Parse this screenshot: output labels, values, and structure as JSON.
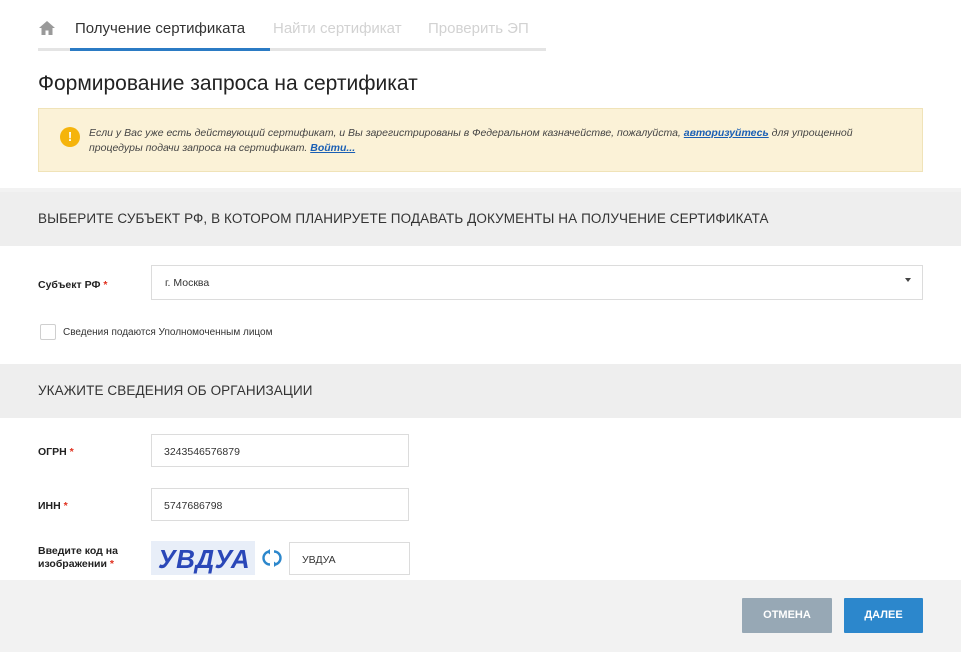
{
  "nav": {
    "tabs": [
      {
        "label": "Получение сертификата",
        "active": true
      },
      {
        "label": "Найти сертификат",
        "active": false
      },
      {
        "label": "Проверить ЭП",
        "active": false
      }
    ],
    "home_icon": "home-icon"
  },
  "page": {
    "title": "Формирование запроса на сертификат"
  },
  "notice": {
    "icon": "info-icon",
    "icon_glyph": "!",
    "text_before": "Если у Вас уже есть действующий сертификат, и Вы зарегистрированы в Федеральном казначействе, пожалуйста,",
    "link_authorize": "авторизуйтесь",
    "text_after": "для упрощенной процедуры подачи запроса на сертификат.",
    "link_login": "Войти..."
  },
  "section_region": {
    "header": "ВЫБЕРИТЕ СУБЪЕКТ РФ, В КОТОРОМ ПЛАНИРУЕТЕ ПОДАВАТЬ ДОКУМЕНТЫ НА ПОЛУЧЕНИЕ СЕРТИФИКАТА",
    "subject_label": "Субъект РФ",
    "subject_value": "г. Москва",
    "checkbox_label": "Сведения подаются Уполномоченным лицом",
    "checkbox_checked": false
  },
  "section_org": {
    "header": "УКАЖИТЕ СВЕДЕНИЯ ОБ ОРГАНИЗАЦИИ",
    "ogrn_label": "ОГРН",
    "ogrn_value": "3243546576879",
    "inn_label": "ИНН",
    "inn_value": "5747686798",
    "captcha_label_1": "Введите код на",
    "captcha_label_2": "изображении",
    "captcha_image_text": "УВДУА",
    "captcha_value": "УВДУА"
  },
  "required_mark": "*",
  "buttons": {
    "cancel": "ОТМЕНА",
    "next": "ДАЛЕЕ"
  },
  "colors": {
    "accent": "#2b7bc4",
    "next_button": "#2c87cc",
    "cancel_button": "#97a8b5",
    "required": "#e0301e",
    "notice_bg": "#fbf2d7",
    "notice_icon": "#f5b40c"
  }
}
